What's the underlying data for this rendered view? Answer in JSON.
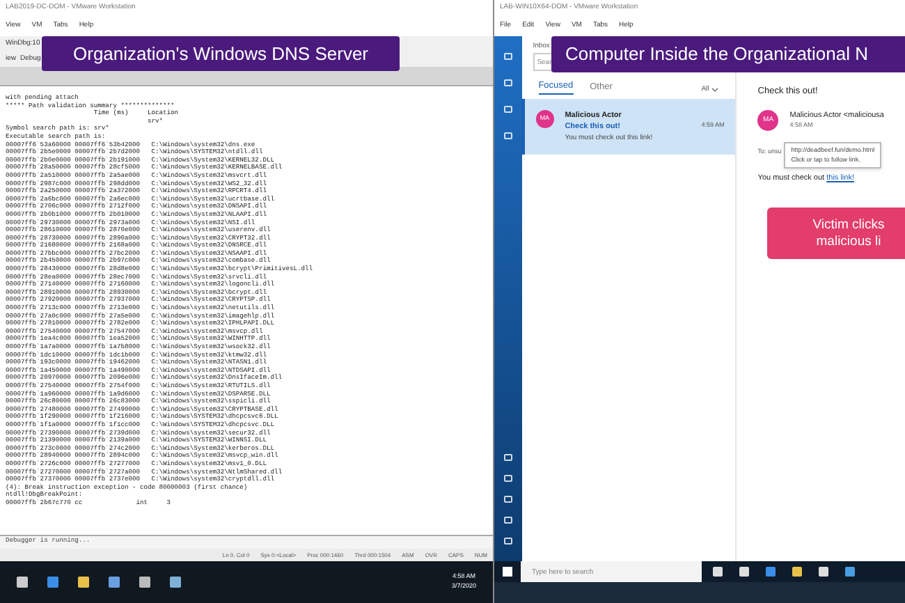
{
  "left_vm": {
    "title": "LAB2019-DC-DOM - VMware Workstation",
    "menu": [
      "View",
      "VM",
      "Tabs",
      "Help"
    ],
    "windbg": {
      "title": "WinDbg:10",
      "menu": [
        "iew",
        "Debug"
      ],
      "log_header": [
        "with pending attach",
        "***** Path validation summary **************",
        "                       Time (ms)     Location",
        "                                     srv*",
        "Symbol search path is: srv*",
        "Executable search path is:"
      ],
      "modules": [
        "00007ff6`53a60000 00007ff6`53b42000   C:\\Windows\\system32\\dns.exe",
        "00007ffb`2b5e0000 00007ffb`2b7d2000   C:\\Windows\\SYSTEM32\\ntdll.dll",
        "00007ffb`2b0e0000 00007ffb`2b191000   C:\\Windows\\System32\\KERNEL32.DLL",
        "00007ffb`28a50000 00007ffb`28cf5000   C:\\Windows\\System32\\KERNELBASE.dll",
        "00007ffb`2a510000 00007ffb`2a5ae000   C:\\Windows\\System32\\msvcrt.dll",
        "00007ffb`2987c000 00007ffb`298dd000   C:\\Windows\\System32\\WS2_32.dll",
        "00007ffb`2a250000 00007ffb`2a372000   C:\\Windows\\System32\\RPCRT4.dll",
        "00007ffb`2a6bc000 00007ffb`2a6ec000   C:\\Windows\\System32\\ucrtbase.dll",
        "00007ffb`2706c000 00007ffb`2712f000   C:\\Windows\\system32\\DNSAPI.dll",
        "00007ffb`2b0b1000 00007ffb`2b010000   C:\\Windows\\System32\\NLAAPI.dll",
        "00007ffb`29730000 00007ffb`2973a000   C:\\Windows\\System32\\NSI.dll",
        "00007ffb`28610000 00007ffb`2870e000   C:\\Windows\\system32\\userenv.dll",
        "00007ffb`28730000 00007ffb`2890a000   C:\\Windows\\System32\\CRYPT32.dll",
        "00007ffb`21680000 00007ffb`2168a000   C:\\Windows\\System32\\DNSRCE.dll",
        "00007ffb`27bbc000 00007ffb`27bc2000   C:\\Windows\\System32\\NSAAPI.dll",
        "00007ffb`2b450000 00007ffb`2b97c000   C:\\Windows\\system32\\combase.dll",
        "00007ffb`28430000 00007ffb`28d8e000   C:\\Windows\\System32\\bcrypt\\PrimitivesL.dll",
        "00007ffb`28ea0000 00007ffb`28ec7000   C:\\Windows\\System32\\srvcli.dll",
        "00007ffb`27140000 00007ffb`27160000   C:\\Windows\\system32\\logoncli.dll",
        "00007ffb`28910000 00007ffb`28930000   C:\\Windows\\System32\\bcrypt.dll",
        "00007ffb`27920000 00007ffb`27937000   C:\\Windows\\System32\\CRYPTSP.dll",
        "00007ffb`2713c000 00007ffb`2713e000   C:\\Windows\\system32\\netutils.dll",
        "00007ffb`27a0c000 00007ffb`27a5e000   C:\\Windows\\system32\\imagehlp.dll",
        "00007ffb`27810000 00007ffb`2782e000   C:\\Windows\\system32\\IPHLPAPI.DLL",
        "00007ffb`27540000 00007ffb`27547000   C:\\Windows\\system32\\msvcp.dll",
        "00007ffb`1ea4c000 00007ffb`1ea52000   C:\\Windows\\System32\\WINHTTP.dll",
        "00007ffb`1a7a0000 00007ffb`1a7b8000   C:\\Windows\\System32\\wsock32.dll",
        "00007ffb`1dc10000 00007ffb`1dc1b000   C:\\Windows\\System32\\ktmw32.dll",
        "00007ffb`193c0000 00007ffb`19462000   C:\\Windows\\System32\\NTASN1.dll",
        "00007ffb`1a450000 00007ffb`1a490000   C:\\Windows\\system32\\NTDSAPI.dll",
        "00007ffb`20970000 00007ffb`2096e000   C:\\Windows\\system32\\DnsIfaceIm.dll",
        "00007ffb`27540000 00007ffb`2754f000   C:\\Windows\\System32\\RTUTILS.dll",
        "00007ffb`1a960000 00007ffb`1a9d6000   C:\\Windows\\System32\\DSPARSE.DLL",
        "00007ffb`26c80000 00007ffb`26c83000   C:\\Windows\\system32\\sspicli.dll",
        "00007ffb`27480000 00007ffb`27490000   C:\\Windows\\System32\\CRYPTBASE.dll",
        "00007ffb`1f290000 00007ffb`1f216000   C:\\Windows\\SYSTEM32\\dhcpcsvc6.DLL",
        "00007ffb`1f1a0000 00007ffb`1f1cc000   C:\\Windows\\SYSTEM32\\dhcpcsvc.DLL",
        "00007ffb`27390000 00007ffb`2739d000   C:\\Windows\\system32\\secur32.dll",
        "00007ffb`21390000 00007ffb`2139a000   C:\\Windows\\SYSTEM32\\WINNSI.DLL",
        "00007ffb`273c0000 00007ffb`274c2000   C:\\Windows\\System32\\kerberos.DLL",
        "00007ffb`28940000 00007ffb`2894c000   C:\\Windows\\System32\\msvcp_win.dll",
        "00007ffb`2726c000 00007ffb`27277000   C:\\Windows\\system32\\msv1_0.DLL",
        "00007ffb`27270000 00007ffb`2727a000   C:\\Windows\\system32\\NtlmShared.dll",
        "00007ffb`27370000 00007ffb`2737e000   C:\\Windows\\system32\\cryptdll.dll"
      ],
      "log_footer": [
        "(4): Break instruction exception - code 80000003 (first chance)",
        "ntdll!DbgBreakPoint:",
        "00007ffb`2b67c770 cc              int     3"
      ],
      "command_status": "Debugger is running...",
      "status_bar": [
        "Ln 0, Col 0",
        "Sys 0:<Local>",
        "Proc 000:1460",
        "Thrd 000:1504",
        "ASM",
        "OVR",
        "CAPS",
        "NUM"
      ]
    },
    "clock": {
      "time": "4:58 AM",
      "date": "3/7/2020"
    }
  },
  "right_vm": {
    "title": "LAB-WIN10X64-DOM - VMware Workstation",
    "menu": [
      "File",
      "Edit",
      "View",
      "VM",
      "Tabs",
      "Help"
    ],
    "mail": {
      "folder": "Inbox",
      "search": {
        "placeholder": "Sear"
      },
      "tabs": [
        {
          "label": "Focused",
          "selected": true
        },
        {
          "label": "Other",
          "selected": false
        }
      ],
      "filter": "All",
      "messages": [
        {
          "initials": "MA",
          "sender": "Malicious Actor",
          "subject": "Check this out!",
          "time": "4:59 AM",
          "preview": "You must check out this link!",
          "selected": true
        }
      ],
      "reading": {
        "subject": "Check this out!",
        "initials": "MA",
        "from": "Malicious Actor <maliciousa",
        "time": "4:58 AM",
        "to": "To: unsu",
        "tooltip": {
          "url": "http://deadbeef.fun/demo.html",
          "hint": "Click or tap to follow link."
        },
        "body": "You must check out ",
        "link": "this link!"
      }
    },
    "search": {
      "placeholder": "Type here to search"
    }
  },
  "overlays": {
    "left_banner": "Organization's Windows DNS Server",
    "right_banner": "Computer Inside the Organizational N",
    "callout": [
      "Victim clicks",
      "malicious li"
    ]
  }
}
